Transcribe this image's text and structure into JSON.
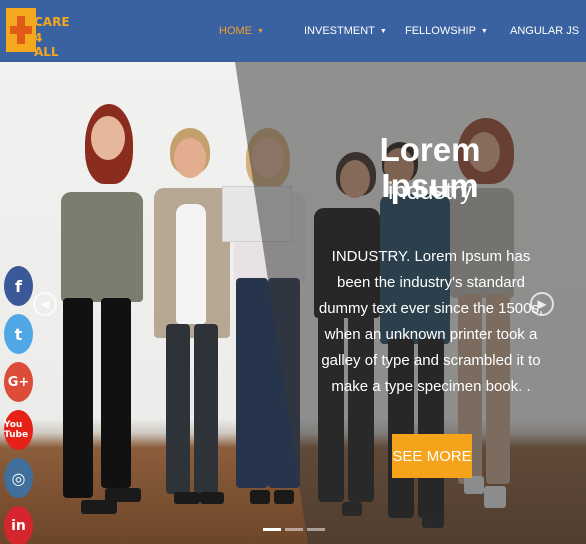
{
  "brand": {
    "logo_line1": "CARE",
    "logo_line2": "4 ALL"
  },
  "nav": {
    "items": [
      {
        "label": "HOME",
        "caret": "▼"
      },
      {
        "label": "INVESTMENT",
        "caret": "▼"
      },
      {
        "label": "FELLOWSHIP",
        "caret": "▼"
      },
      {
        "label": "ANGULAR JS",
        "caret": ""
      }
    ],
    "active_color": "#f0a030"
  },
  "slide": {
    "title": "Lorem Ipsum",
    "subtitle": "industry",
    "body": "INDUSTRY. Lorem Ipsum has been the industry's standard dummy text ever since the 1500s, when an unknown printer took a galley of type and scrambled it to make a type specimen book. .",
    "cta_label": "SEE MORE",
    "indicators_count": 3,
    "active_indicator": 1
  },
  "social": [
    {
      "name": "facebook-icon",
      "glyph": "f"
    },
    {
      "name": "twitter-icon",
      "glyph": "t"
    },
    {
      "name": "google-plus-icon",
      "glyph": "G+"
    },
    {
      "name": "youtube-icon",
      "glyph": "You Tube"
    },
    {
      "name": "instagram-icon",
      "glyph": "◎"
    },
    {
      "name": "linkedin-icon",
      "glyph": "in"
    }
  ],
  "colors": {
    "header_bg": "#3a62a0",
    "accent": "#f5a31a"
  }
}
